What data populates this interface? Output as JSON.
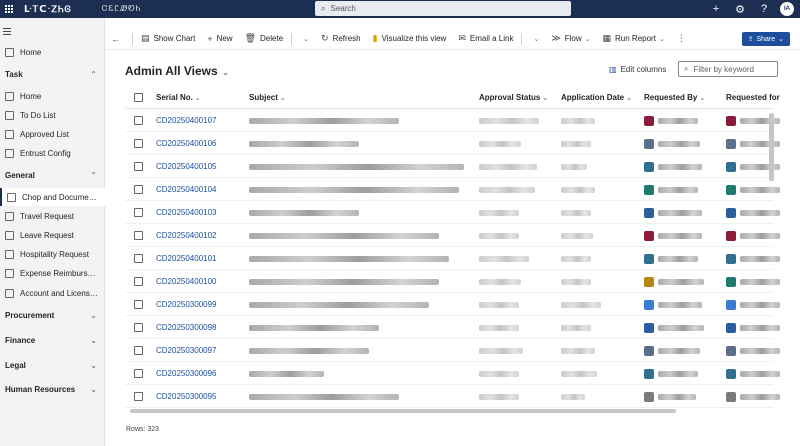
{
  "topbar": {
    "app_title": "ᒷᎢᑕᐧᏃᏂᎶ",
    "env_name": "ᏣᏋᏝᏪᏬᏂ",
    "search_placeholder": "Search",
    "avatar_initials": "IA"
  },
  "sidebar": {
    "home": "Home",
    "groups": [
      {
        "label": "Task",
        "items": [
          "Home",
          "To Do List",
          "Approved List",
          "Entrust Config"
        ]
      },
      {
        "label": "General",
        "items": [
          "Chop and Document...",
          "Travel Request",
          "Leave Request",
          "Hospitality Request",
          "Expense Reimburse...",
          "Account and License..."
        ]
      },
      {
        "label": "Procurement",
        "items": []
      },
      {
        "label": "Finance",
        "items": []
      },
      {
        "label": "Legal",
        "items": []
      },
      {
        "label": "Human Resources",
        "items": []
      }
    ]
  },
  "commandbar": {
    "show_chart": "Show Chart",
    "new": "New",
    "delete": "Delete",
    "refresh": "Refresh",
    "visualize": "Visualize this view",
    "email_link": "Email a Link",
    "flow": "Flow",
    "run_report": "Run Report",
    "share": "Share"
  },
  "view": {
    "title": "Admin All Views",
    "edit_columns": "Edit columns",
    "filter_placeholder": "Filter by keyword"
  },
  "columns": [
    "Serial No.",
    "Subject",
    "Approval Status",
    "Application Date",
    "Requested By",
    "Requested for"
  ],
  "rows": [
    {
      "serial": "CD20250400107",
      "req_color": "#8a1c3a",
      "for_color": "#8a1c3a"
    },
    {
      "serial": "CD20250400106",
      "req_color": "#5a6f8a",
      "for_color": "#5a6f8a"
    },
    {
      "serial": "CD20250400105",
      "req_color": "#2e6e8e",
      "for_color": "#2e6e8e"
    },
    {
      "serial": "CD20250400104",
      "req_color": "#1e7a6e",
      "for_color": "#1e7a6e"
    },
    {
      "serial": "CD20250400103",
      "req_color": "#2a5e9c",
      "for_color": "#2a5e9c"
    },
    {
      "serial": "CD20250400102",
      "req_color": "#8a1c3a",
      "for_color": "#8a1c3a"
    },
    {
      "serial": "CD20250400101",
      "req_color": "#2e6e8e",
      "for_color": "#2e6e8e"
    },
    {
      "serial": "CD20250400100",
      "req_color": "#b8860b",
      "for_color": "#1e7a6e"
    },
    {
      "serial": "CD20250300099",
      "req_color": "#3a7bd5",
      "for_color": "#3a7bd5"
    },
    {
      "serial": "CD20250300098",
      "req_color": "#2a5e9c",
      "for_color": "#2a5e9c"
    },
    {
      "serial": "CD20250300097",
      "req_color": "#5a6f8a",
      "for_color": "#5a6f8a"
    },
    {
      "serial": "CD20250300096",
      "req_color": "#2e6e8e",
      "for_color": "#2e6e8e"
    },
    {
      "serial": "CD20250300095",
      "req_color": "#7a7a7a",
      "for_color": "#7a7a7a"
    }
  ],
  "footer": {
    "rows_count": "Rows: 323"
  }
}
